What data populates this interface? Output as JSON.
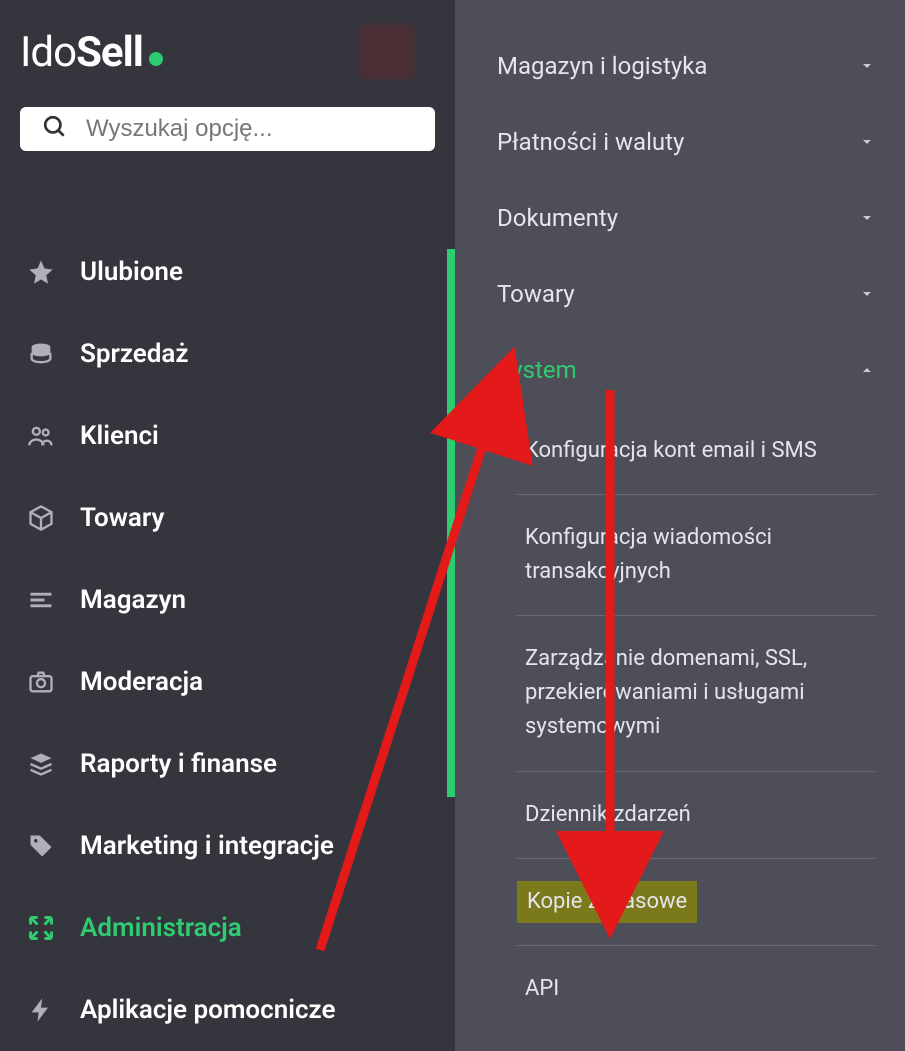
{
  "brand": {
    "part1": "Ido",
    "part2": "Sell"
  },
  "search": {
    "placeholder": "Wyszukaj opcję..."
  },
  "nav": {
    "favorites": "Ulubione",
    "sales": "Sprzedaż",
    "clients": "Klienci",
    "products": "Towary",
    "warehouse": "Magazyn",
    "moderation": "Moderacja",
    "reports": "Raporty i finanse",
    "marketing": "Marketing i integracje",
    "administration": "Administracja",
    "apps": "Aplikacje pomocnicze"
  },
  "panel": {
    "logistics": "Magazyn i logistyka",
    "payments": "Płatności i waluty",
    "documents": "Dokumenty",
    "products": "Towary",
    "system": "System",
    "system_items": {
      "email_sms": "Konfiguracja kont email i SMS",
      "transactional": "Konfiguracja wiadomości transakcyjnych",
      "domains": "Zarządzanie domenami, SSL, przekierowaniami i usługami systemowymi",
      "events": "Dziennik zdarzeń",
      "backups": "Kopie zapasowe",
      "api": "API"
    }
  }
}
